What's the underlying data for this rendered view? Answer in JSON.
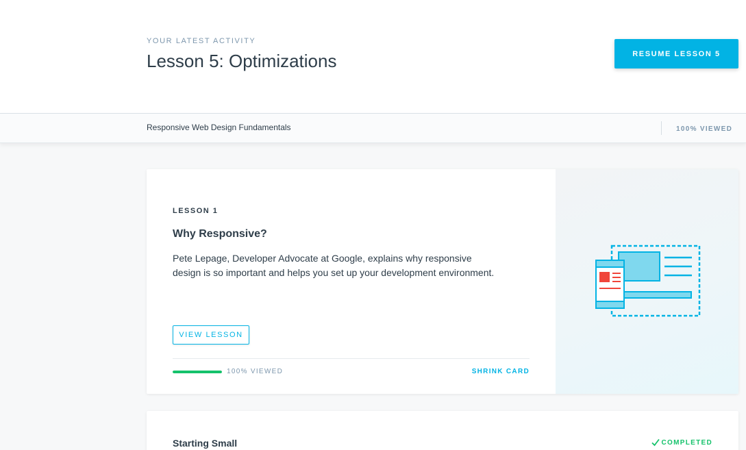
{
  "header": {
    "eyebrow": "YOUR LATEST ACTIVITY",
    "title": "Lesson 5: Optimizations",
    "resume_label": "RESUME LESSON 5"
  },
  "course_bar": {
    "course_name": "Responsive Web Design Fundamentals",
    "progress_label": "100% VIEWED"
  },
  "lesson_card": {
    "lesson_number": "LESSON 1",
    "title": "Why Responsive?",
    "description": "Pete Lepage, Developer Advocate at Google, explains why responsive design is so important and helps you set up your development environment.",
    "view_label": "VIEW LESSON",
    "progress_percent": 100,
    "progress_label": "100% VIEWED",
    "shrink_label": "SHRINK CARD",
    "illustration_icon": "responsive-devices-icon"
  },
  "next_card": {
    "title": "Starting Small",
    "status_label": "COMPLETED",
    "status_icon": "checkmark-icon"
  },
  "colors": {
    "accent": "#02b3e4",
    "success": "#15c26b",
    "text": "#2e3d49",
    "muted": "#7d97ad",
    "illustration_red": "#f0453a"
  }
}
